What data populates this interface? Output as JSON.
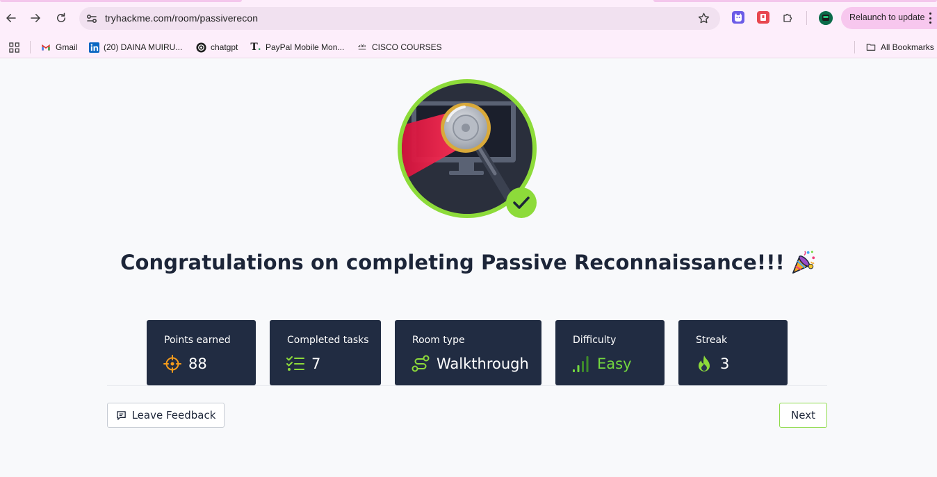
{
  "browser": {
    "url": "tryhackme.com/room/passiverecon",
    "relaunch_label": "Relaunch to update",
    "bookmarks": [
      {
        "label": "Gmail",
        "icon": "gmail-icon"
      },
      {
        "label": "(20) DAINA MUIRU...",
        "icon": "linkedin-icon"
      },
      {
        "label": "chatgpt",
        "icon": "openai-icon"
      },
      {
        "label": "PayPal Mobile Mon...",
        "icon": "t-logo-icon"
      },
      {
        "label": "CISCO COURSES",
        "icon": "cisco-icon"
      }
    ],
    "all_bookmarks_label": "All Bookmarks"
  },
  "page": {
    "headline": "Congratulations on completing Passive Reconnaissance!!!",
    "stats": [
      {
        "label": "Points earned",
        "value": "88",
        "icon": "target-icon"
      },
      {
        "label": "Completed tasks",
        "value": "7",
        "icon": "checklist-icon"
      },
      {
        "label": "Room type",
        "value": "Walkthrough",
        "icon": "route-icon"
      },
      {
        "label": "Difficulty",
        "value": "Easy",
        "icon": "signal-bars-icon"
      },
      {
        "label": "Streak",
        "value": "3",
        "icon": "flame-icon"
      }
    ],
    "feedback_label": "Leave Feedback",
    "next_label": "Next"
  },
  "colors": {
    "accent_green": "#8ddb4a",
    "card_bg": "#212c42",
    "points_orange": "#f59b1b",
    "easy_green": "#74d93f"
  }
}
